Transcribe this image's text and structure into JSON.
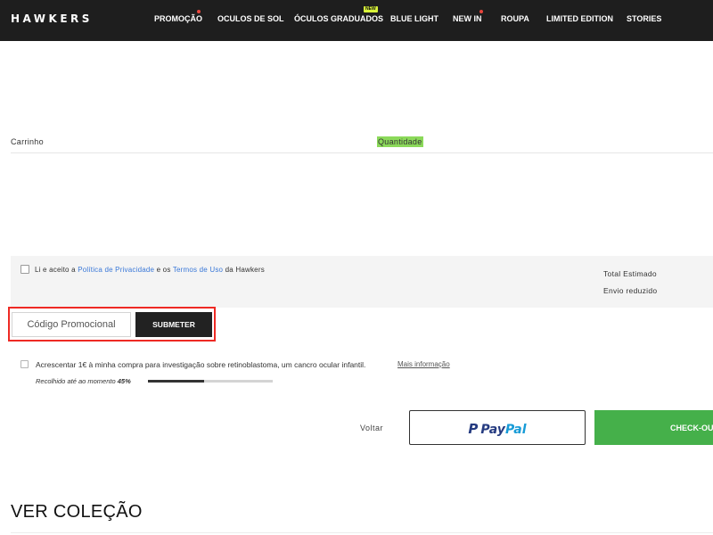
{
  "header": {
    "logo": "HAWKERS",
    "nav": [
      {
        "label": "PROMOÇÃO",
        "dot": true
      },
      {
        "label": "OCULOS DE SOL"
      },
      {
        "label": "ÓCULOS GRADUADOS",
        "badge": "NEW"
      },
      {
        "label": "BLUE LIGHT"
      },
      {
        "label": "NEW IN",
        "dot": true
      },
      {
        "label": "ROUPA"
      },
      {
        "label": "LIMITED EDITION"
      },
      {
        "label": "STORIES"
      }
    ]
  },
  "cart": {
    "title": "Carrinho",
    "quantity_label": "Quantidade"
  },
  "summary": {
    "terms": {
      "prefix": "Li e aceito a",
      "privacy_link": "Política de Privacidade",
      "middle": "e os",
      "terms_link": "Termos de Uso",
      "suffix": "da Hawkers"
    },
    "total_label": "Total Estimado",
    "shipping_label": "Envio reduzido"
  },
  "promo": {
    "placeholder": "Código Promocional",
    "submit_label": "SUBMETER"
  },
  "donation": {
    "text": "Acrescentar 1€ à minha compra para investigação sobre retinoblastoma, um cancro ocular infantil.",
    "more_link": "Mais informação",
    "collected_label": "Recolhido até ao momento",
    "collected_value": "45%",
    "progress": 0.45
  },
  "actions": {
    "back_label": "Voltar",
    "paypal_pay": "Pay",
    "paypal_pal": "Pal",
    "paypal_mark": "P",
    "checkout_label": "CHECK-OUT"
  },
  "collection": {
    "title": "VER COLEÇÃO"
  },
  "colors": {
    "header_bg": "#1e1e1e",
    "highlight": "#8bd95a",
    "link": "#3a78d8",
    "promo_frame": "#ee2a24",
    "checkout": "#45b04a",
    "paypal_dark": "#253b80",
    "paypal_light": "#179bd7"
  }
}
